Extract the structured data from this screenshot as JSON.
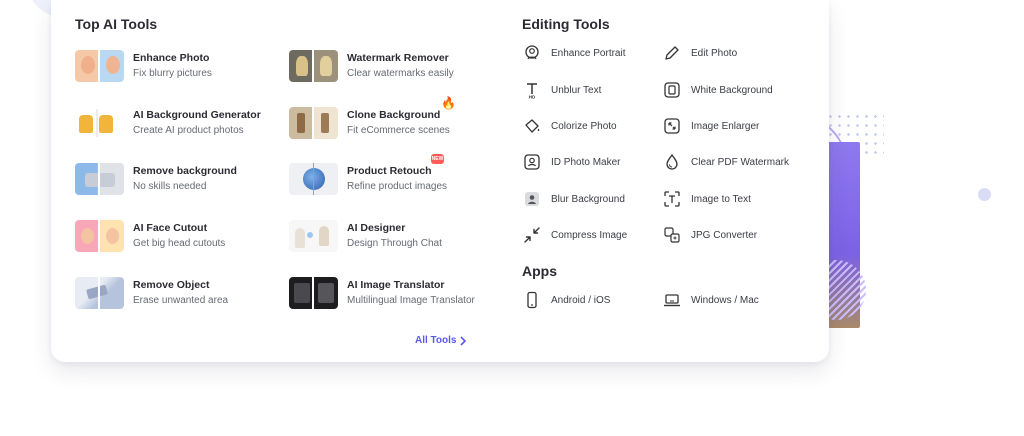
{
  "top_ai_tools": {
    "title": "Top AI Tools",
    "items": [
      {
        "name": "Enhance Photo",
        "desc": "Fix blurry pictures"
      },
      {
        "name": "Watermark Remover",
        "desc": "Clear watermarks easily"
      },
      {
        "name": "AI Background Generator",
        "desc": "Create AI product photos"
      },
      {
        "name": "Clone Background",
        "desc": "Fit eCommerce scenes",
        "badge": "hot"
      },
      {
        "name": "Remove background",
        "desc": "No skills needed"
      },
      {
        "name": "Product Retouch",
        "desc": "Refine product images",
        "badge": "new"
      },
      {
        "name": "AI Face Cutout",
        "desc": "Get big head cutouts"
      },
      {
        "name": "AI Designer",
        "desc": "Design Through Chat"
      },
      {
        "name": "Remove Object",
        "desc": "Erase unwanted area"
      },
      {
        "name": "AI Image Translator",
        "desc": "Multilingual Image Translator"
      }
    ],
    "new_badge_text": "NEW"
  },
  "editing_tools": {
    "title": "Editing Tools",
    "items": [
      {
        "label": "Enhance Portrait",
        "icon": "portrait-icon"
      },
      {
        "label": "Edit Photo",
        "icon": "pencil-icon"
      },
      {
        "label": "Unblur Text",
        "icon": "text-hd-icon"
      },
      {
        "label": "White Background",
        "icon": "white-background-icon"
      },
      {
        "label": "Colorize Photo",
        "icon": "paint-bucket-icon"
      },
      {
        "label": "Image Enlarger",
        "icon": "enlarge-icon"
      },
      {
        "label": "ID Photo Maker",
        "icon": "id-card-icon"
      },
      {
        "label": "Clear PDF Watermark",
        "icon": "droplet-icon"
      },
      {
        "label": "Blur Background",
        "icon": "blur-background-icon"
      },
      {
        "label": "Image to Text",
        "icon": "image-to-text-icon"
      },
      {
        "label": "Compress Image",
        "icon": "compress-icon"
      },
      {
        "label": "JPG Converter",
        "icon": "converter-icon"
      }
    ]
  },
  "apps": {
    "title": "Apps",
    "items": [
      {
        "label": "Android / iOS",
        "icon": "phone-icon"
      },
      {
        "label": "Windows / Mac",
        "icon": "laptop-icon"
      }
    ]
  },
  "footer": {
    "all_tools_label": "All Tools"
  },
  "colors": {
    "accent": "#5b58f0",
    "heading": "#2b2b33",
    "muted": "#666a73",
    "hot": "#f25c2b",
    "new": "#ff5b5b"
  }
}
